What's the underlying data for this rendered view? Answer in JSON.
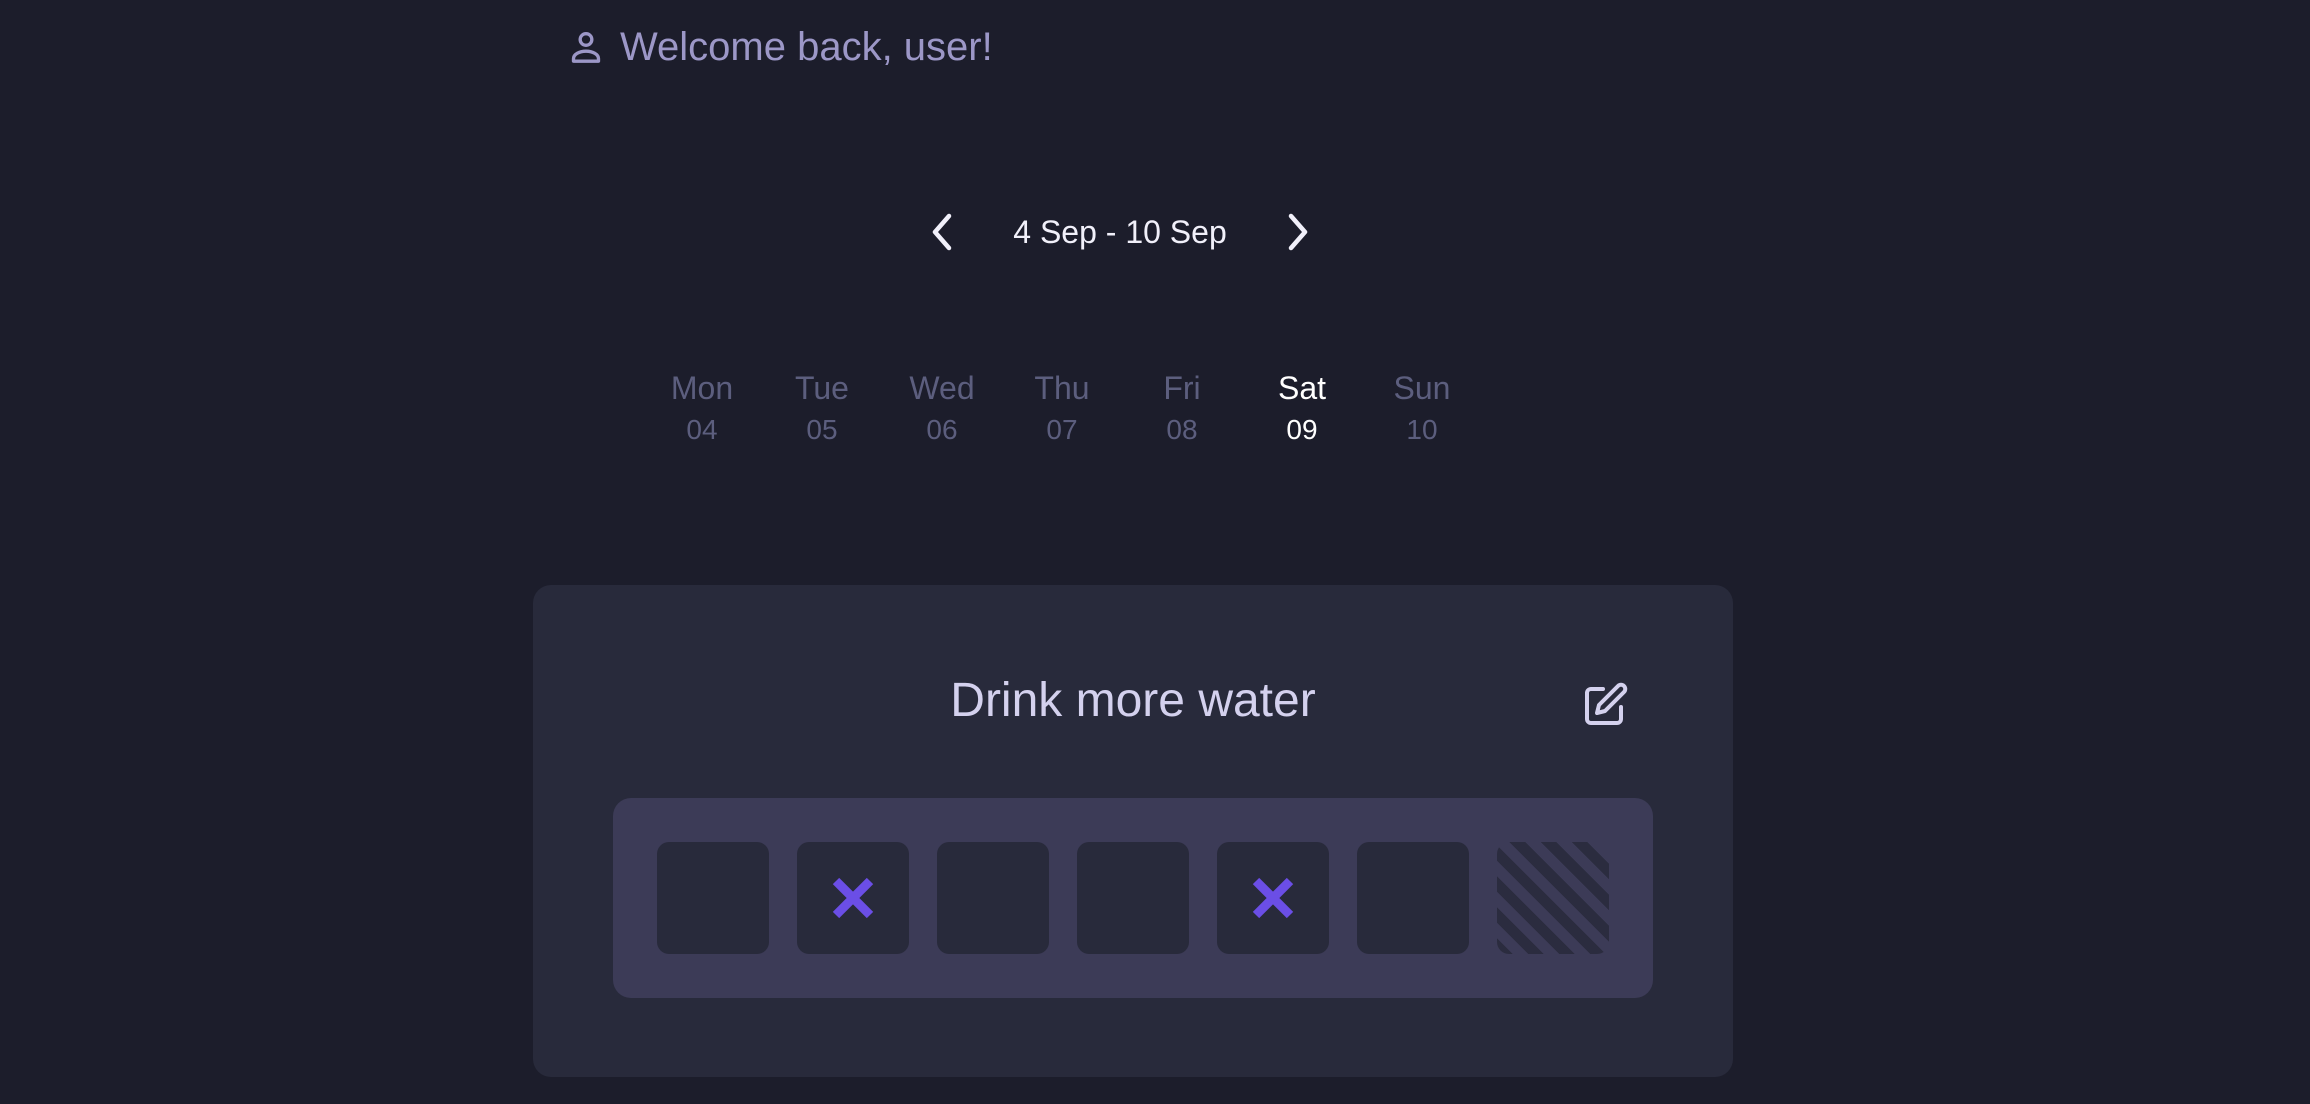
{
  "header": {
    "welcome_text": "Welcome back, user!",
    "user_icon": "user-icon"
  },
  "week_nav": {
    "range": "4 Sep - 10 Sep",
    "prev_icon": "chevron-left-icon",
    "next_icon": "chevron-right-icon"
  },
  "days": [
    {
      "name": "Mon",
      "date": "04"
    },
    {
      "name": "Tue",
      "date": "05"
    },
    {
      "name": "Wed",
      "date": "06"
    },
    {
      "name": "Thu",
      "date": "07"
    },
    {
      "name": "Fri",
      "date": "08"
    },
    {
      "name": "Sat",
      "date": "09"
    },
    {
      "name": "Sun",
      "date": "10"
    }
  ],
  "selected_day": "Sat",
  "habit": {
    "title": "Drink more water",
    "edit_icon": "edit-icon",
    "tracker": [
      {
        "day": "Mon",
        "state": "empty"
      },
      {
        "day": "Tue",
        "state": "missed"
      },
      {
        "day": "Wed",
        "state": "empty"
      },
      {
        "day": "Thu",
        "state": "empty"
      },
      {
        "day": "Fri",
        "state": "missed"
      },
      {
        "day": "Sat",
        "state": "empty"
      },
      {
        "day": "Sun",
        "state": "future"
      }
    ]
  },
  "colors": {
    "background": "#1c1d2b",
    "card": "#282a3b",
    "tracker_bg": "#3c3b57",
    "accent": "#6b4ee6",
    "welcome_text": "#9c97c7",
    "inactive_day": "#5c5e7e",
    "active_day": "#ffffff"
  }
}
